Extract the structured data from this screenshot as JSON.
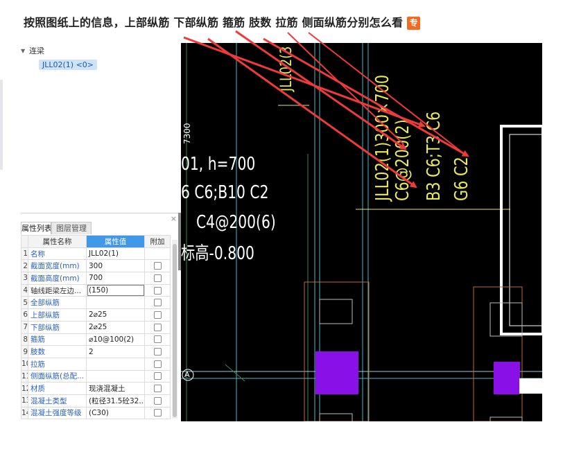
{
  "question": {
    "text": "按照图纸上的信息，上部纵筋 下部纵筋 箍筋 肢数 拉筋 侧面纵筋分别怎么看",
    "badge": "专"
  },
  "tree": {
    "root_label": "连梁",
    "child_label": "JLL02(1) <0>"
  },
  "panel": {
    "close": "×",
    "tabs": [
      "属性列表",
      "图层管理"
    ],
    "headers": {
      "name": "属性名称",
      "value": "属性值",
      "extra": "附加"
    },
    "rows": [
      {
        "idx": "1",
        "name": "名称",
        "value": "JLL02(1)"
      },
      {
        "idx": "2",
        "name": "截面宽度(mm)",
        "value": "300"
      },
      {
        "idx": "3",
        "name": "截面高度(mm)",
        "value": "700"
      },
      {
        "idx": "4",
        "name": "轴线距梁左边...",
        "value": "(150)"
      },
      {
        "idx": "5",
        "name": "全部纵筋",
        "value": ""
      },
      {
        "idx": "6",
        "name": "上部纵筋",
        "value": "2⌀25"
      },
      {
        "idx": "7",
        "name": "下部纵筋",
        "value": "2⌀25"
      },
      {
        "idx": "8",
        "name": "箍筋",
        "value": "⌀10@100(2)"
      },
      {
        "idx": "9",
        "name": "肢数",
        "value": "2"
      },
      {
        "idx": "10",
        "name": "拉筋",
        "value": ""
      },
      {
        "idx": "11",
        "name": "侧面纵筋(总配...",
        "value": ""
      },
      {
        "idx": "12",
        "name": "材质",
        "value": "现浇混凝土"
      },
      {
        "idx": "13",
        "name": "混凝土类型",
        "value": "(粒径31.5砼32...."
      },
      {
        "idx": "14",
        "name": "混凝土强度等级",
        "value": "(C30)"
      }
    ]
  },
  "cad": {
    "dim_7300": "7300",
    "h700": "01, h=700",
    "line_c": "6   C6;B10    C2",
    "stirrup": "C4@200(6)",
    "elev": "标高-0.800",
    "jll02_top": "JLL02(3",
    "v_col1": "JLL02(1)300×700",
    "v_col2": "C6@200(2)",
    "v_col3": "B3 C6;T3 C6",
    "v_col4": "G6 C2",
    "axis_a": "A"
  },
  "colors": {
    "cad_bg": "#000000",
    "cad_yellow": "#e8e85a",
    "cad_cyan": "#4fb7c8",
    "cad_purple": "#8a10e8",
    "arrow_red": "#ee3a3a",
    "badge": "#f26b21",
    "header_blue": "#3f98e8"
  }
}
